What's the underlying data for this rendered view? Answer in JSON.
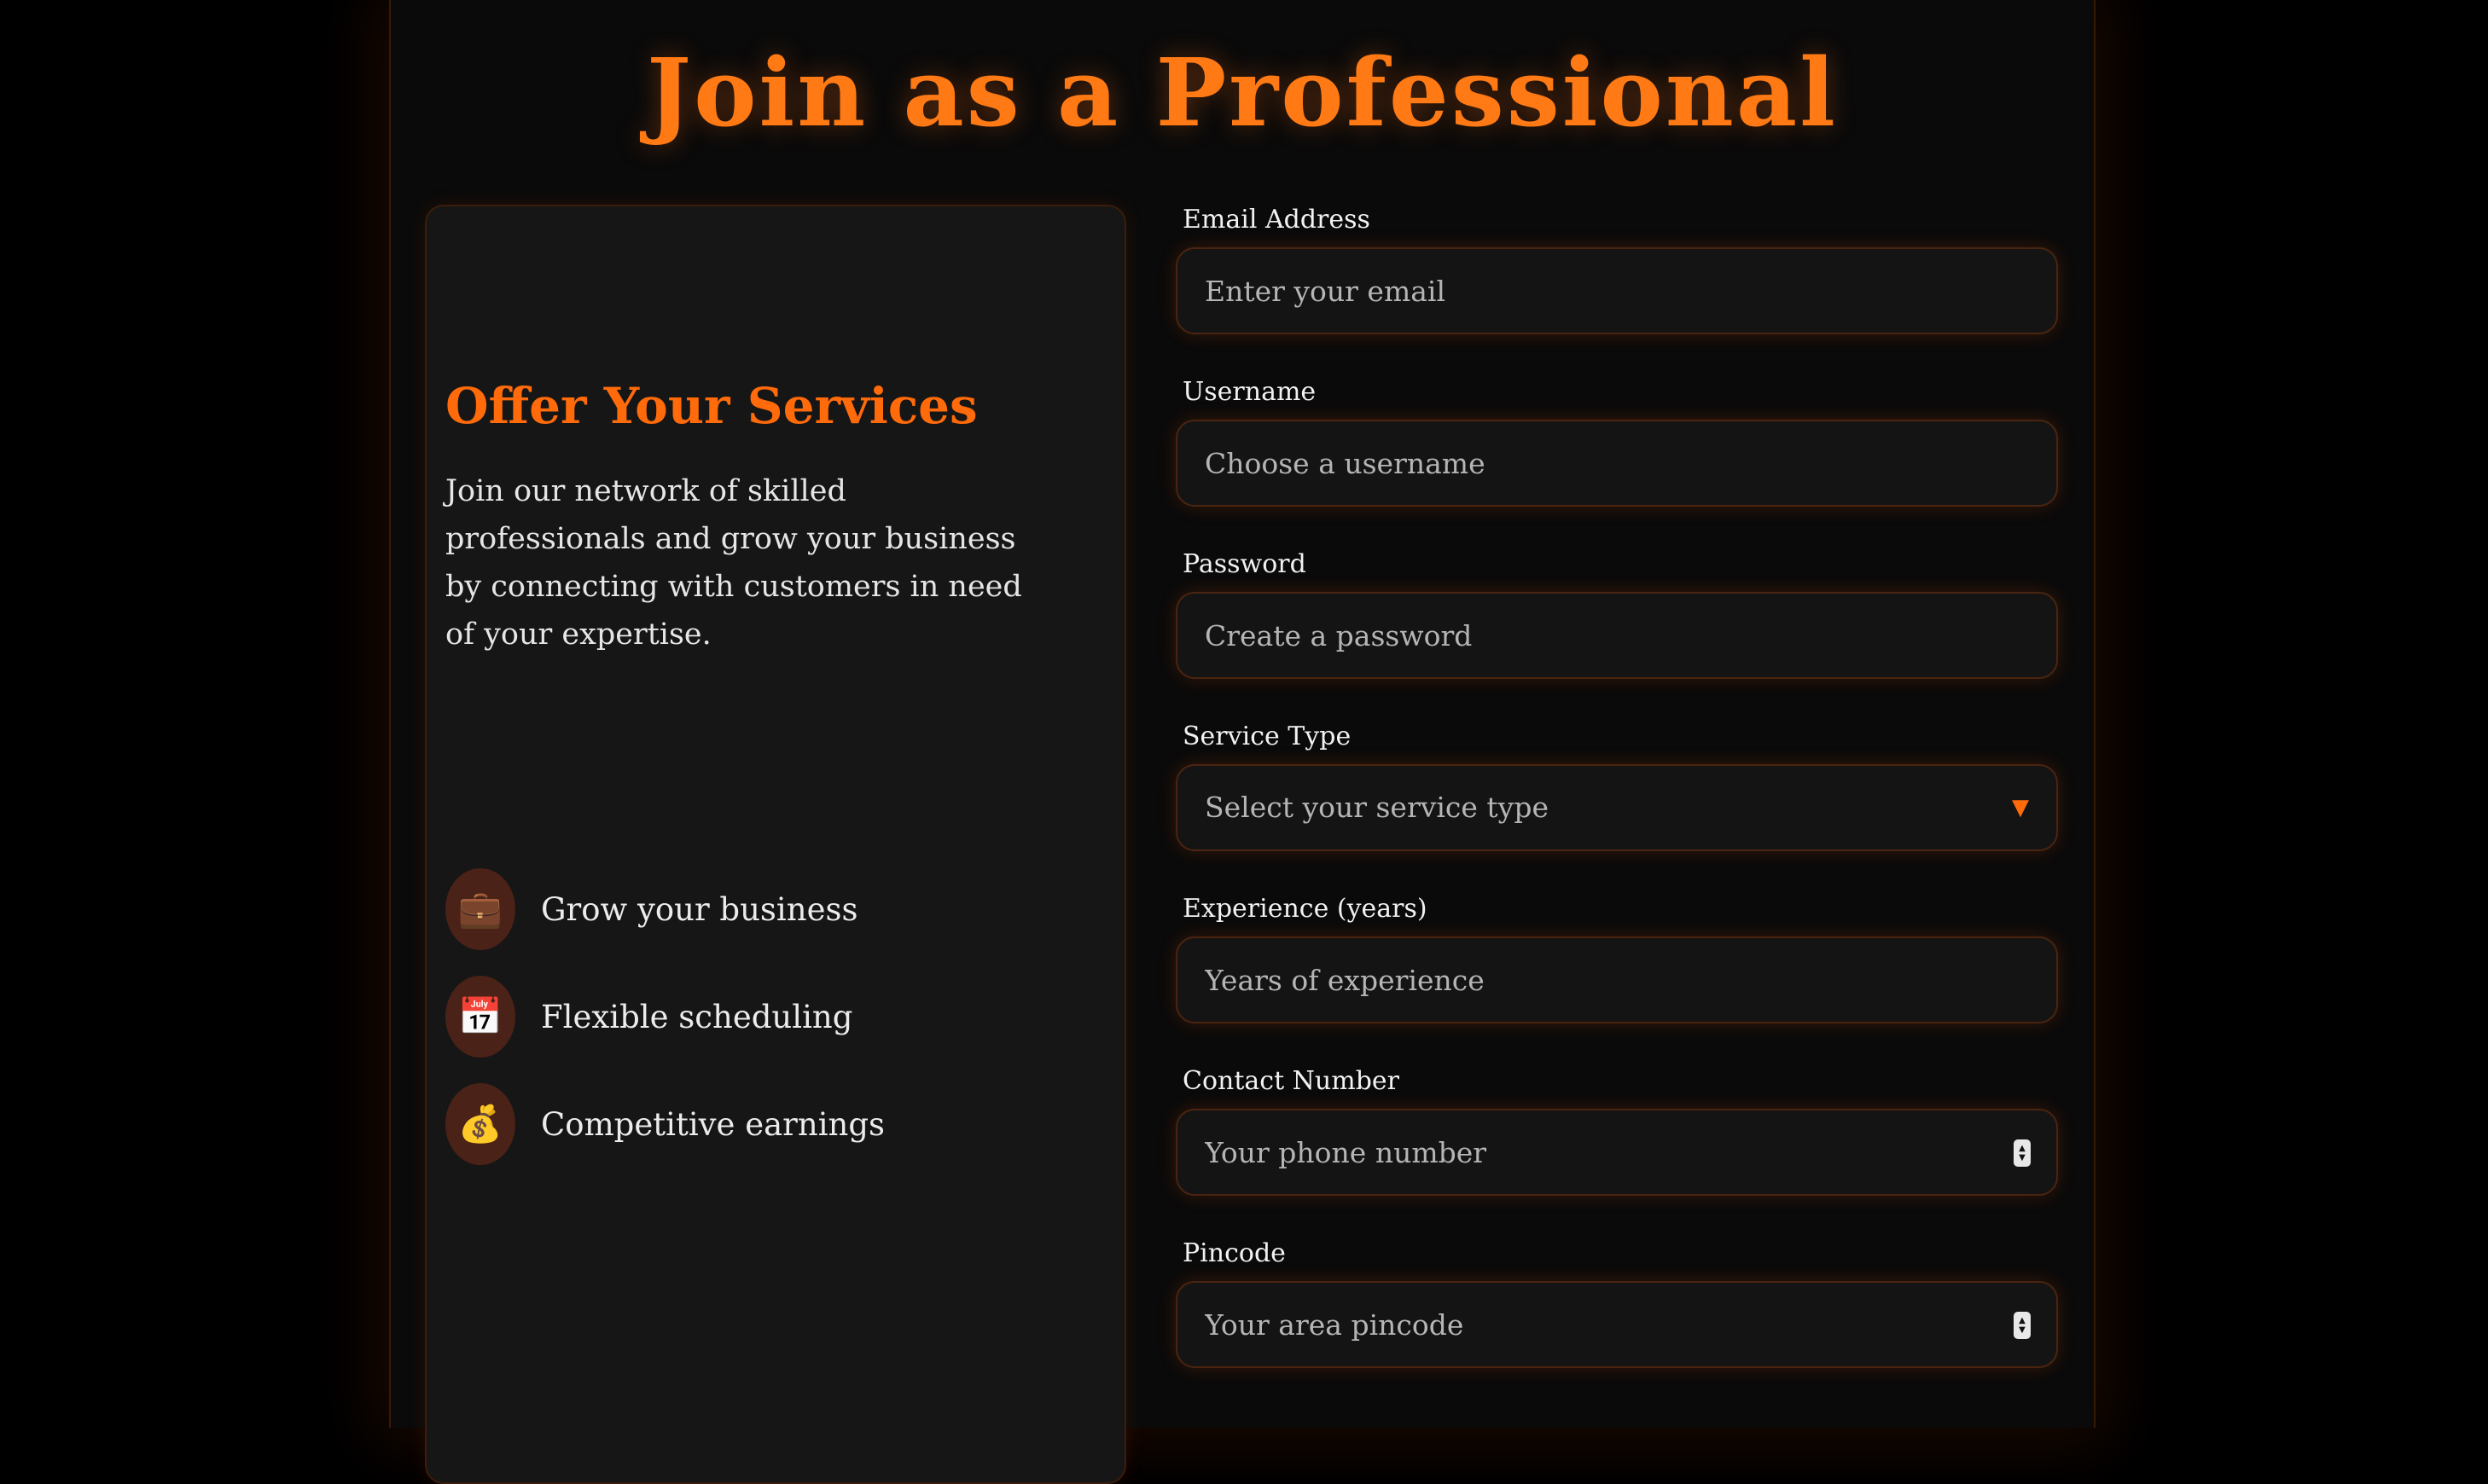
{
  "page": {
    "title": "Join as a Professional",
    "accent_color": "#ff6a0a"
  },
  "info": {
    "heading": "Offer Your Services",
    "description": "Join our network of skilled professionals and grow your business by connecting with customers in need of your expertise.",
    "features": [
      {
        "icon": "briefcase-icon",
        "glyph": "💼",
        "label": "Grow your business"
      },
      {
        "icon": "calendar-icon",
        "glyph": "📅",
        "label": "Flexible scheduling"
      },
      {
        "icon": "money-bag-icon",
        "glyph": "💰",
        "label": "Competitive earnings"
      }
    ]
  },
  "form": {
    "email": {
      "label": "Email Address",
      "placeholder": "Enter your email"
    },
    "username": {
      "label": "Username",
      "placeholder": "Choose a username"
    },
    "password": {
      "label": "Password",
      "placeholder": "Create a password"
    },
    "service_type": {
      "label": "Service Type",
      "selected": "Select your service type",
      "arrow": "▼"
    },
    "experience": {
      "label": "Experience (years)",
      "placeholder": "Years of experience"
    },
    "contact": {
      "label": "Contact Number",
      "placeholder": "Your phone number"
    },
    "pincode": {
      "label": "Pincode",
      "placeholder": "Your area pincode"
    }
  }
}
